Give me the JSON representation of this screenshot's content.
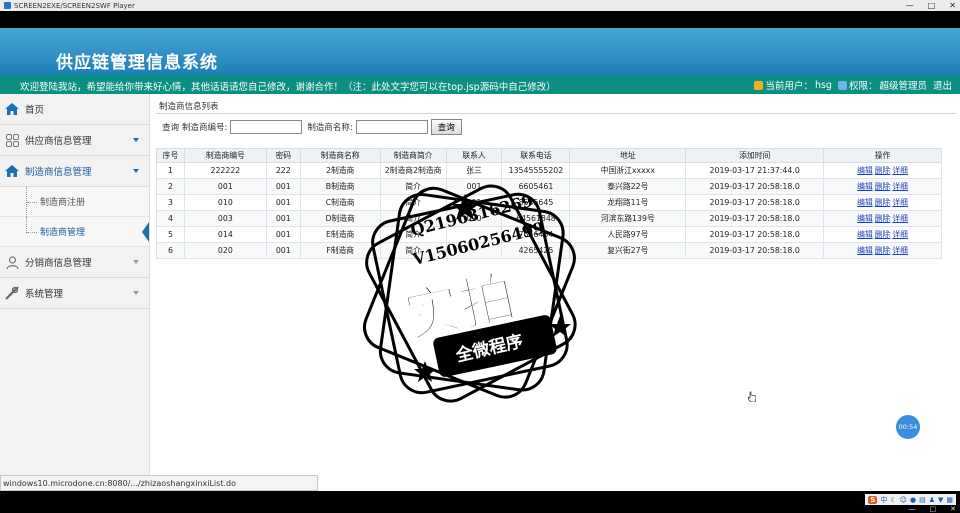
{
  "player": {
    "title": "SCREEN2EXE/SCREEN2SWF Player",
    "minimize": "—",
    "maximize": "□",
    "close": "✕"
  },
  "header": {
    "system_title": "供应链管理信息系统",
    "welcome": "欢迎登陆我站，希望能给你带来好心情，其他话语请您自己修改，谢谢合作！（注：此处文字您可以在top.jsp源码中自己修改）",
    "current_user_label": "当前用户：",
    "current_user": "hsg",
    "role_label": "权限：",
    "role": "超级管理员",
    "logout": "退出"
  },
  "sidebar": {
    "items": [
      {
        "label": "首页",
        "icon": "home-icon"
      },
      {
        "label": "供应商信息管理",
        "icon": "grid-icon"
      },
      {
        "label": "制造商信息管理",
        "icon": "home-icon"
      },
      {
        "label": "分销商信息管理",
        "icon": "user-icon"
      },
      {
        "label": "系统管理",
        "icon": "tools-icon"
      }
    ],
    "subitems": [
      {
        "label": "制造商注册"
      },
      {
        "label": "制造商管理"
      }
    ]
  },
  "main": {
    "panel_title": "制造商信息列表",
    "search": {
      "label": "查询",
      "code_label": "制造商编号:",
      "name_label": "制造商名称:",
      "code_value": "",
      "name_value": "",
      "button": "查询"
    },
    "table": {
      "headers": [
        "序号",
        "制造商编号",
        "密码",
        "制造商名称",
        "制造商简介",
        "联系人",
        "联系电话",
        "地址",
        "添加时间",
        "操作"
      ],
      "rows": [
        [
          "1",
          "222222",
          "222",
          "2制造商",
          "2制造商2制造商",
          "张三",
          "13545555202",
          "中国浙江xxxxx",
          "2019-03-17 21:37:44.0"
        ],
        [
          "2",
          "001",
          "001",
          "B制造商",
          "简介",
          "001",
          "6605461",
          "泰兴路22号",
          "2019-03-17 20:58:18.0"
        ],
        [
          "3",
          "010",
          "001",
          "C制造商",
          "简介",
          "001",
          "8545645",
          "龙翔路11号",
          "2019-03-17 20:58:18.0"
        ],
        [
          "4",
          "003",
          "001",
          "D制造商",
          "简介",
          "020",
          "64561848",
          "河滨东路139号",
          "2019-03-17 20:58:18.0"
        ],
        [
          "5",
          "014",
          "001",
          "E制造商",
          "简介",
          "",
          "7656454",
          "人民路97号",
          "2019-03-17 20:58:18.0"
        ],
        [
          "6",
          "020",
          "001",
          "F制造商",
          "简介",
          "",
          "4265425",
          "复兴街27号",
          "2019-03-17 20:58:18.0"
        ]
      ],
      "ops": [
        "编辑",
        "删除",
        "详细"
      ]
    }
  },
  "watermark": {
    "line1": "Q2196316269",
    "line2": "V15060256499",
    "big": "实拍",
    "banner": "全微程序"
  },
  "statusbar": {
    "url": "windows10.microdone.cn:8080/.../zhizaoshangxinxiList.do"
  },
  "timer": "00:54",
  "tray": {
    "ime": "S",
    "lang": "中"
  }
}
